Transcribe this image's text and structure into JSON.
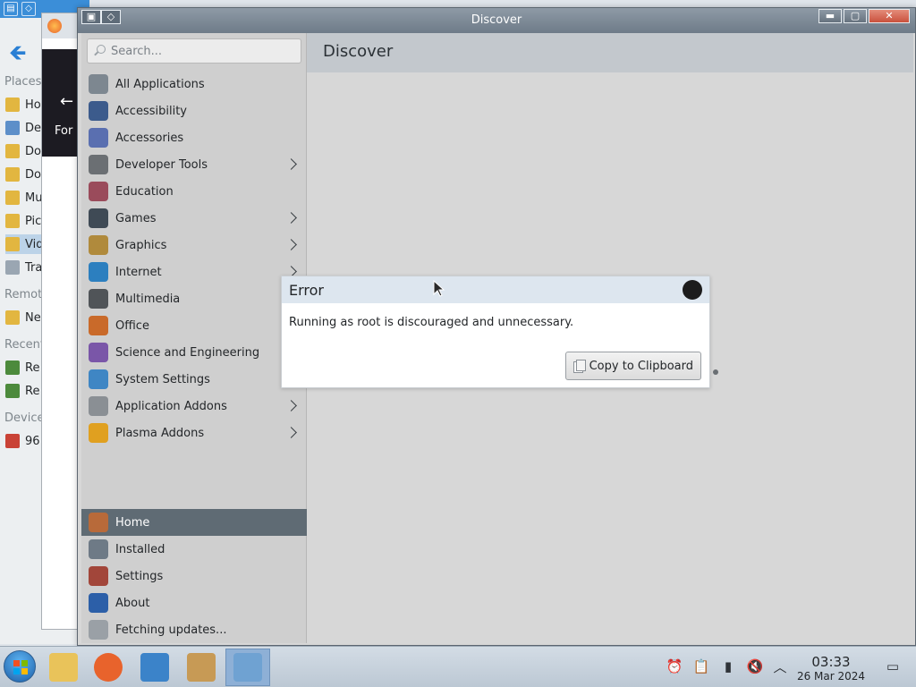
{
  "background_file_manager": {
    "places_heading": "Places",
    "remote_heading": "Remote",
    "recent_heading": "Recent",
    "devices_heading": "Devices",
    "items": [
      {
        "label": "Ho",
        "icon": "home-folder-icon"
      },
      {
        "label": "De",
        "icon": "desktop-folder-icon"
      },
      {
        "label": "Do",
        "icon": "documents-folder-icon"
      },
      {
        "label": "Do",
        "icon": "downloads-folder-icon"
      },
      {
        "label": "Mu",
        "icon": "music-folder-icon"
      },
      {
        "label": "Pic",
        "icon": "pictures-folder-icon"
      },
      {
        "label": "Vid",
        "icon": "videos-folder-icon"
      },
      {
        "label": "Tra",
        "icon": "trash-icon"
      },
      {
        "label": "Ne",
        "icon": "network-folder-icon"
      },
      {
        "label": "Re",
        "icon": "recent-files-icon"
      },
      {
        "label": "Re",
        "icon": "recent-locations-icon"
      },
      {
        "label": "96",
        "icon": "drive-icon"
      }
    ]
  },
  "background_browser": {
    "partial_text": "For"
  },
  "window": {
    "title": "Discover"
  },
  "sidebar": {
    "search_placeholder": "Search...",
    "categories": [
      {
        "label": "All Applications",
        "icon": "grid-icon",
        "color": "#7d8790",
        "has_submenu": false
      },
      {
        "label": "Accessibility",
        "icon": "accessibility-icon",
        "color": "#3c5b8c",
        "has_submenu": false
      },
      {
        "label": "Accessories",
        "icon": "accessories-icon",
        "color": "#5a6fb0",
        "has_submenu": false
      },
      {
        "label": "Developer Tools",
        "icon": "developer-tools-icon",
        "color": "#6b6f73",
        "has_submenu": true
      },
      {
        "label": "Education",
        "icon": "education-icon",
        "color": "#9a4b5b",
        "has_submenu": false
      },
      {
        "label": "Games",
        "icon": "games-icon",
        "color": "#3f4a55",
        "has_submenu": true
      },
      {
        "label": "Graphics",
        "icon": "graphics-icon",
        "color": "#b08a3c",
        "has_submenu": true
      },
      {
        "label": "Internet",
        "icon": "internet-icon",
        "color": "#2c7fbf",
        "has_submenu": true
      },
      {
        "label": "Multimedia",
        "icon": "multimedia-icon",
        "color": "#505458",
        "has_submenu": false
      },
      {
        "label": "Office",
        "icon": "office-icon",
        "color": "#c96a2a",
        "has_submenu": false
      },
      {
        "label": "Science and Engineering",
        "icon": "science-icon",
        "color": "#7a56a8",
        "has_submenu": false
      },
      {
        "label": "System Settings",
        "icon": "system-settings-icon",
        "color": "#3f86c4",
        "has_submenu": false
      },
      {
        "label": "Application Addons",
        "icon": "application-addons-icon",
        "color": "#8a8f94",
        "has_submenu": true
      },
      {
        "label": "Plasma Addons",
        "icon": "plasma-addons-icon",
        "color": "#e0a020",
        "has_submenu": true
      }
    ],
    "bottom": [
      {
        "label": "Home",
        "icon": "home-icon",
        "color": "#b86a3a",
        "active": true
      },
      {
        "label": "Installed",
        "icon": "installed-list-icon",
        "color": "#6e7a86",
        "active": false
      },
      {
        "label": "Settings",
        "icon": "settings-tools-icon",
        "color": "#a2463a",
        "active": false
      },
      {
        "label": "About",
        "icon": "about-icon",
        "color": "#2c5fa8",
        "active": false
      },
      {
        "label": "Fetching updates...",
        "icon": "updates-icon",
        "color": "#9aa0a6",
        "active": false
      }
    ]
  },
  "main": {
    "header": "Discover"
  },
  "error_dialog": {
    "title": "Error",
    "message": "Running as root is discouraged and unnecessary.",
    "copy_button": "Copy to Clipboard"
  },
  "taskbar": {
    "apps": [
      {
        "name": "file-manager",
        "icon": "folder-icon",
        "color": "#e9c35a",
        "active": false
      },
      {
        "name": "firefox",
        "icon": "firefox-icon",
        "color": "#e8632c",
        "active": false
      },
      {
        "name": "system-monitor",
        "icon": "system-monitor-icon",
        "color": "#3b83c9",
        "active": false
      },
      {
        "name": "package-installer",
        "icon": "package-icon",
        "color": "#c79a55",
        "active": false
      },
      {
        "name": "discover",
        "icon": "discover-icon",
        "color": "#6fa2d2",
        "active": true
      }
    ],
    "tray": [
      "notifications-icon",
      "clipboard-icon",
      "battery-icon",
      "volume-muted-icon",
      "tray-expand-icon"
    ],
    "clock_time": "03:33",
    "clock_date": "26 Mar 2024",
    "show_desktop": "show-desktop-icon"
  }
}
